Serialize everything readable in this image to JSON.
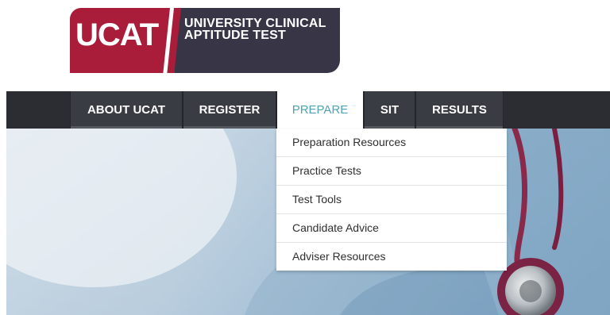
{
  "logo": {
    "abbr": "UCAT",
    "line1": "UNIVERSITY CLINICAL",
    "line2": "APTITUDE TEST"
  },
  "nav": {
    "items": [
      {
        "label": "ABOUT UCAT"
      },
      {
        "label": "REGISTER"
      },
      {
        "label": "PREPARE"
      },
      {
        "label": "SIT"
      },
      {
        "label": "RESULTS"
      }
    ],
    "active": "PREPARE"
  },
  "dropdown": {
    "items": [
      {
        "label": "Preparation Resources"
      },
      {
        "label": "Practice Tests"
      },
      {
        "label": "Test Tools"
      },
      {
        "label": "Candidate Advice"
      },
      {
        "label": "Adviser Resources"
      }
    ]
  },
  "colors": {
    "brand_red": "#a91d3a",
    "brand_dark": "#383547",
    "nav_bg": "#2b2d33",
    "active_text": "#4ea2b2"
  },
  "hero": {
    "image": "doctor-with-stethoscope-photo"
  }
}
